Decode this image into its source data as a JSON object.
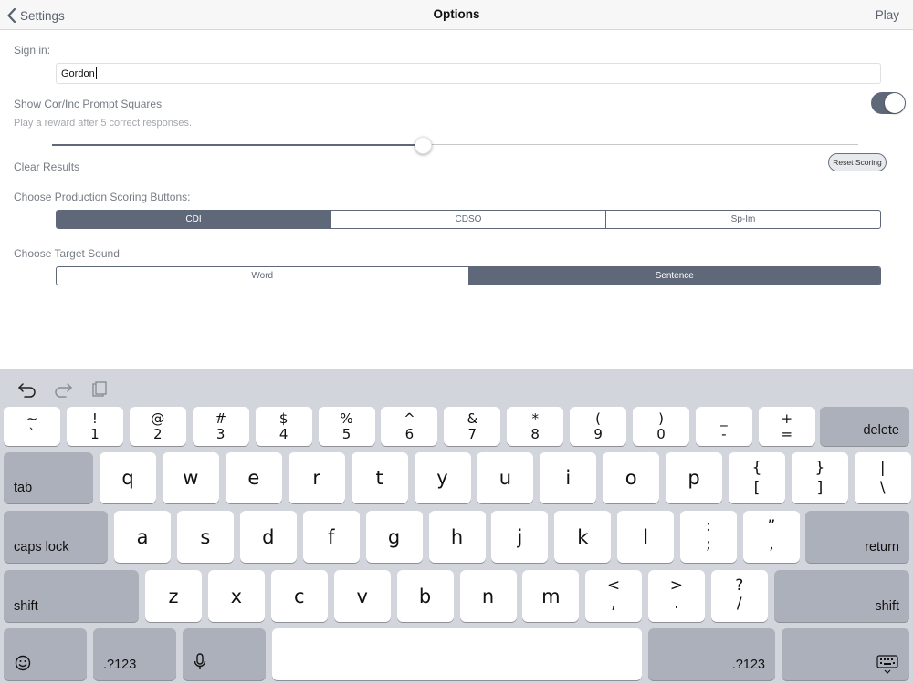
{
  "nav": {
    "back_label": "Settings",
    "title": "Options",
    "play_label": "Play"
  },
  "signin": {
    "label": "Sign in:",
    "value": "Gordon"
  },
  "prompt_squares": {
    "label": "Show Cor/Inc Prompt Squares",
    "enabled": true,
    "hint": "Play a reward after 5 correct responses.",
    "reward_slider_fraction": 0.46
  },
  "clear_results": {
    "label": "Clear Results",
    "reset_button": "Reset Scoring"
  },
  "scoring_buttons": {
    "label": "Choose Production Scoring Buttons:",
    "options": [
      "CDI",
      "CDSO",
      "Sp-Im"
    ],
    "selected": "CDI"
  },
  "target_sound": {
    "label": "Choose Target Sound",
    "options": [
      "Word",
      "Sentence"
    ],
    "selected": "Sentence"
  },
  "colors": {
    "accent": "#5e6878",
    "keyboard_bg": "#d2d5db",
    "function_key": "#abb0ba"
  },
  "keyboard": {
    "tools": [
      "undo-icon",
      "redo-icon",
      "paste-icon"
    ],
    "row1": [
      [
        "~",
        "`"
      ],
      [
        "!",
        "1"
      ],
      [
        "@",
        "2"
      ],
      [
        "#",
        "3"
      ],
      [
        "$",
        "4"
      ],
      [
        "%",
        "5"
      ],
      [
        "^",
        "6"
      ],
      [
        "&",
        "7"
      ],
      [
        "*",
        "8"
      ],
      [
        "(",
        "9"
      ],
      [
        ")",
        "0"
      ],
      [
        "_",
        "-"
      ],
      [
        "+",
        "="
      ]
    ],
    "delete": "delete",
    "tab": "tab",
    "row2": [
      "q",
      "w",
      "e",
      "r",
      "t",
      "y",
      "u",
      "i",
      "o",
      "p"
    ],
    "row2_sym": [
      [
        "{",
        "["
      ],
      [
        "}",
        "]"
      ],
      [
        "|",
        "\\"
      ]
    ],
    "caps": "caps lock",
    "row3": [
      "a",
      "s",
      "d",
      "f",
      "g",
      "h",
      "j",
      "k",
      "l"
    ],
    "row3_sym": [
      [
        ":",
        ";"
      ],
      [
        "”",
        ","
      ]
    ],
    "return": "return",
    "shift": "shift",
    "row4": [
      "z",
      "x",
      "c",
      "v",
      "b",
      "n",
      "m"
    ],
    "row4_sym": [
      [
        "<",
        ","
      ],
      [
        ">",
        "."
      ],
      [
        "?",
        "/"
      ]
    ],
    "numbers_label": ".?123"
  }
}
